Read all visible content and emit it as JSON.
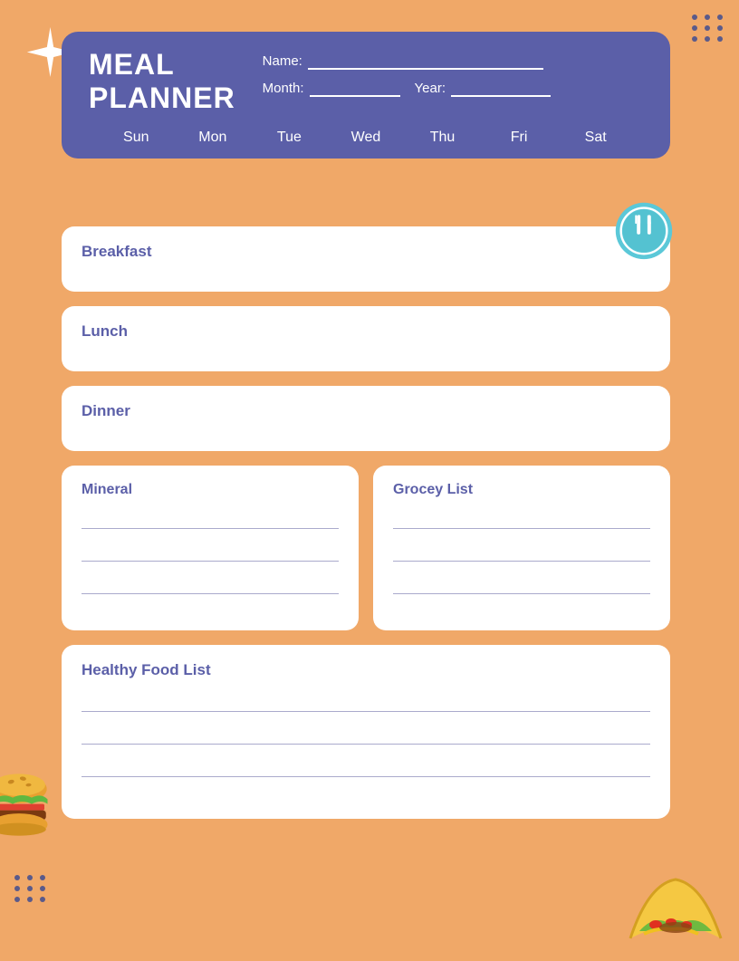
{
  "page": {
    "background_color": "#F0A868",
    "title": "Meal Planner"
  },
  "header": {
    "title_line1": "MEAL",
    "title_line2": "PLANNER",
    "name_label": "Name:",
    "month_label": "Month:",
    "year_label": "Year:",
    "days": [
      "Sun",
      "Mon",
      "Tue",
      "Wed",
      "Thu",
      "Fri",
      "Sat"
    ]
  },
  "sections": {
    "breakfast_label": "Breakfast",
    "lunch_label": "Lunch",
    "dinner_label": "Dinner"
  },
  "mineral": {
    "label": "Mineral",
    "lines": 3
  },
  "grocery": {
    "label": "Grocey List",
    "lines": 3
  },
  "healthy": {
    "label": "Healthy Food List",
    "lines": 3
  },
  "dots": {
    "count": 9
  }
}
